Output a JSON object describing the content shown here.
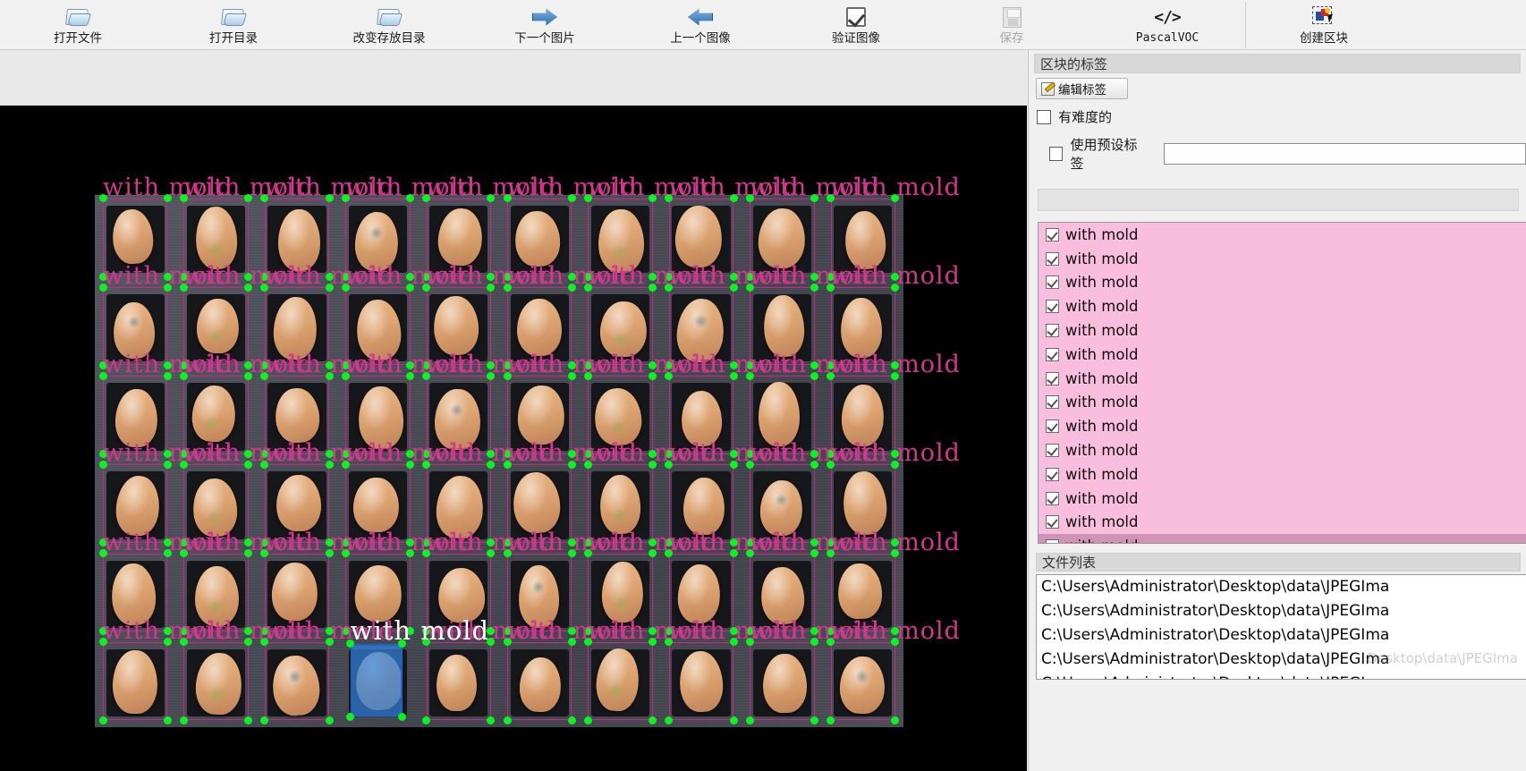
{
  "toolbar": {
    "items": [
      {
        "label": "打开文件",
        "icon": "folder-icon",
        "disabled": false
      },
      {
        "label": "打开目录",
        "icon": "folder-icon",
        "disabled": false
      },
      {
        "label": "改变存放目录",
        "icon": "folder-icon",
        "disabled": false
      },
      {
        "label": "下一个图片",
        "icon": "arrow-right-icon",
        "disabled": false
      },
      {
        "label": "上一个图像",
        "icon": "arrow-left-icon",
        "disabled": false
      },
      {
        "label": "验证图像",
        "icon": "checkmark-icon",
        "disabled": false
      },
      {
        "label": "保存",
        "icon": "save-icon",
        "disabled": true
      },
      {
        "label": "PascalVOC",
        "icon": "code-icon",
        "disabled": false
      },
      {
        "label": "创建区块",
        "icon": "create-block-icon",
        "disabled": false
      }
    ]
  },
  "box_labels_panel": {
    "title": "区块的标签",
    "edit_label_button": "编辑标签",
    "difficult_checkbox": {
      "label": "有难度的",
      "checked": false
    },
    "use_default_checkbox": {
      "label": "使用预设标签",
      "checked": false
    },
    "default_label_value": "",
    "items": [
      {
        "label": "with mold",
        "checked": true,
        "selected": false
      },
      {
        "label": "with mold",
        "checked": true,
        "selected": false
      },
      {
        "label": "with mold",
        "checked": true,
        "selected": false
      },
      {
        "label": "with mold",
        "checked": true,
        "selected": false
      },
      {
        "label": "with mold",
        "checked": true,
        "selected": false
      },
      {
        "label": "with mold",
        "checked": true,
        "selected": false
      },
      {
        "label": "with mold",
        "checked": true,
        "selected": false
      },
      {
        "label": "with mold",
        "checked": true,
        "selected": false
      },
      {
        "label": "with mold",
        "checked": true,
        "selected": false
      },
      {
        "label": "with mold",
        "checked": true,
        "selected": false
      },
      {
        "label": "with mold",
        "checked": true,
        "selected": false
      },
      {
        "label": "with mold",
        "checked": true,
        "selected": false
      },
      {
        "label": "with mold",
        "checked": true,
        "selected": false
      },
      {
        "label": "with mold",
        "checked": true,
        "selected": true
      }
    ]
  },
  "file_list_panel": {
    "title": "文件列表",
    "files": [
      "C:\\Users\\Administrator\\Desktop\\data\\JPEGIma",
      "C:\\Users\\Administrator\\Desktop\\data\\JPEGIma",
      "C:\\Users\\Administrator\\Desktop\\data\\JPEGIma",
      "C:\\Users\\Administrator\\Desktop\\data\\JPEGIma",
      "C:\\Users\\Administrator\\Desktop\\data\\JPEGIma"
    ],
    "watermark": "Desktop\\data\\JPEGIma"
  },
  "canvas": {
    "selected_box_label": "with mold",
    "annotation_label": "with mold",
    "colors": {
      "box_stroke": "#d41f8f",
      "vertex": "#09f520",
      "selected_fill": "#3282dc",
      "selected_stroke": "#1f63c8",
      "label_text": "#d4368f",
      "selected_label_text": "#ffffff",
      "canvas_background": "#000000"
    },
    "grid": {
      "rows": 6,
      "cols": 10
    },
    "row_label_repeats": 10
  }
}
